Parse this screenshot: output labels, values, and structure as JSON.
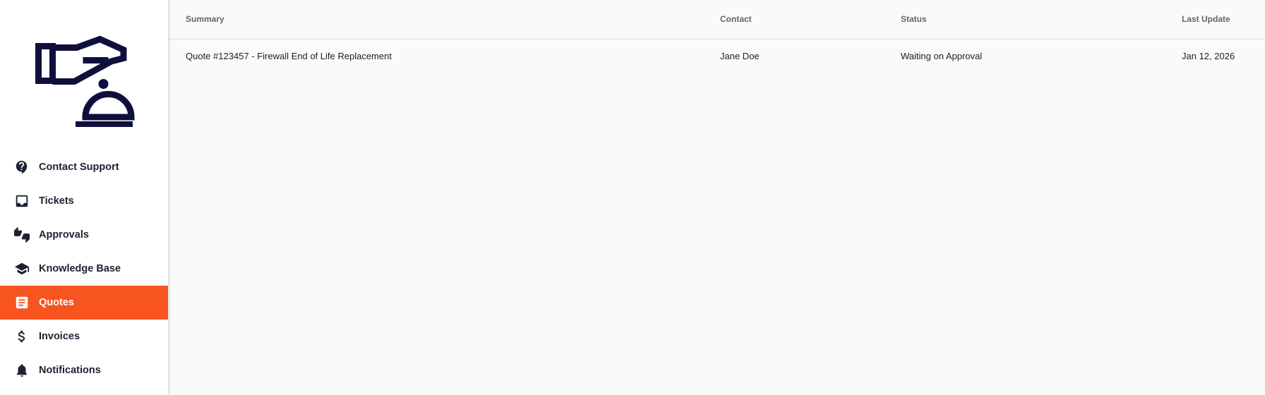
{
  "sidebar": {
    "logo_icon": "concierge-hand-bell-icon",
    "items": [
      {
        "label": "Contact Support",
        "icon": "help-bubble-icon",
        "active": false
      },
      {
        "label": "Tickets",
        "icon": "inbox-tray-icon",
        "active": false
      },
      {
        "label": "Approvals",
        "icon": "thumbs-up-down-icon",
        "active": false
      },
      {
        "label": "Knowledge Base",
        "icon": "graduation-cap-icon",
        "active": false
      },
      {
        "label": "Quotes",
        "icon": "receipt-icon",
        "active": true
      },
      {
        "label": "Invoices",
        "icon": "dollar-icon",
        "active": false
      },
      {
        "label": "Notifications",
        "icon": "bell-icon",
        "active": false
      }
    ]
  },
  "table": {
    "headers": {
      "summary": "Summary",
      "contact": "Contact",
      "status": "Status",
      "last_update": "Last Update"
    },
    "rows": [
      {
        "summary": "Quote #123457 - Firewall End of Life Replacement",
        "contact": "Jane Doe",
        "status": "Waiting on Approval",
        "last_update": "Jan 12, 2026"
      }
    ]
  },
  "colors": {
    "accent": "#f7541f",
    "logo": "#0f0f3d",
    "nav_text": "#1c2233"
  }
}
